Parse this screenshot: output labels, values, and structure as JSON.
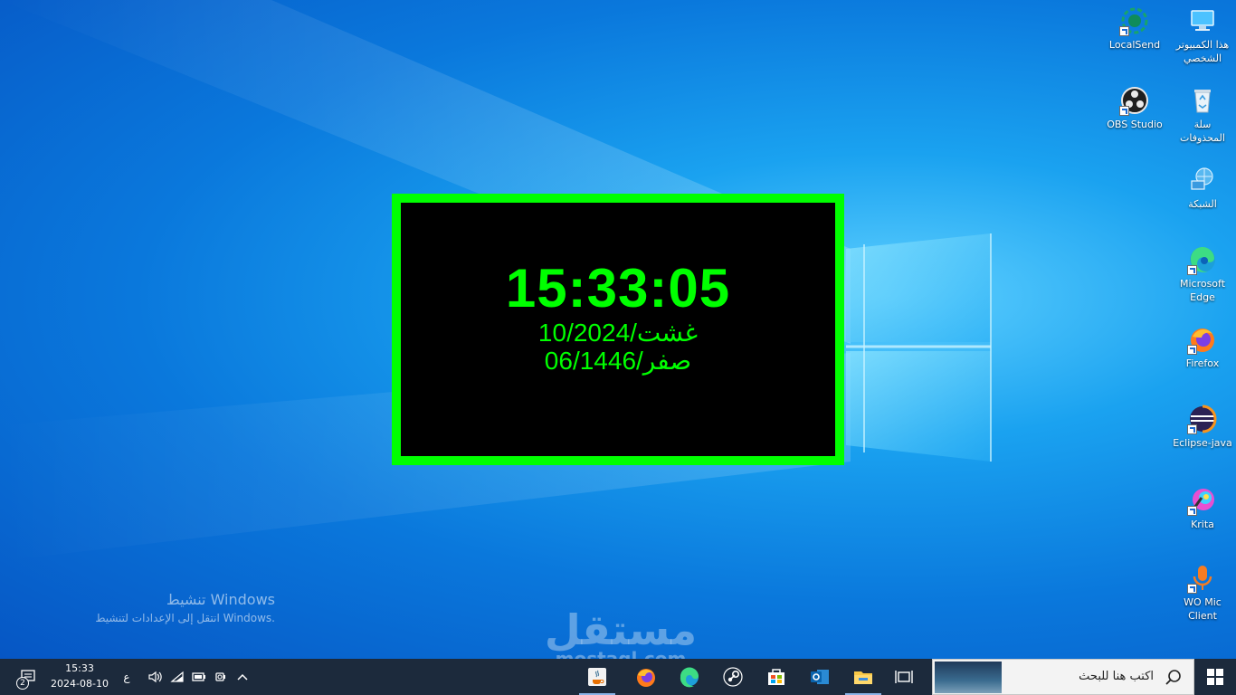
{
  "clock_widget": {
    "time": "15:33:05",
    "gregorian_date": "10/غشت/2024",
    "hijri_date": "06/صفر/1446",
    "border_color": "#00ff00",
    "text_color": "#00ff00",
    "background_color": "#000000"
  },
  "desktop_icons": [
    {
      "label": "هذا الكمبيوتر الشخصي",
      "icon": "computer-icon"
    },
    {
      "label": "LocalSend",
      "icon": "localsend-icon"
    },
    {
      "label": "سلة المحذوفات",
      "icon": "recycle-bin-icon"
    },
    {
      "label": "OBS Studio",
      "icon": "obs-icon"
    },
    {
      "label": "الشبكة",
      "icon": "network-icon"
    },
    {
      "label": "Microsoft Edge",
      "icon": "edge-icon"
    },
    {
      "label": "Firefox",
      "icon": "firefox-icon"
    },
    {
      "label": "Eclipse-java",
      "icon": "eclipse-icon"
    },
    {
      "label": "Krita",
      "icon": "krita-icon"
    },
    {
      "label": "WO Mic Client",
      "icon": "microphone-icon"
    }
  ],
  "activation": {
    "title": "تنشيط Windows",
    "subtitle": "انتقل إلى الإعدادات لتنشيط Windows."
  },
  "watermark": {
    "text": "مستقل",
    "url": "mostaql.com"
  },
  "taskbar": {
    "search_placeholder": "اكتب هنا للبحث",
    "pinned_apps": [
      "java-icon",
      "firefox-icon",
      "edge-icon",
      "steam-icon",
      "store-icon",
      "outlook-icon",
      "file-explorer-icon"
    ],
    "clock_time": "15:33",
    "clock_date": "2024-08-10",
    "language": "ع",
    "notification_count": "2"
  }
}
